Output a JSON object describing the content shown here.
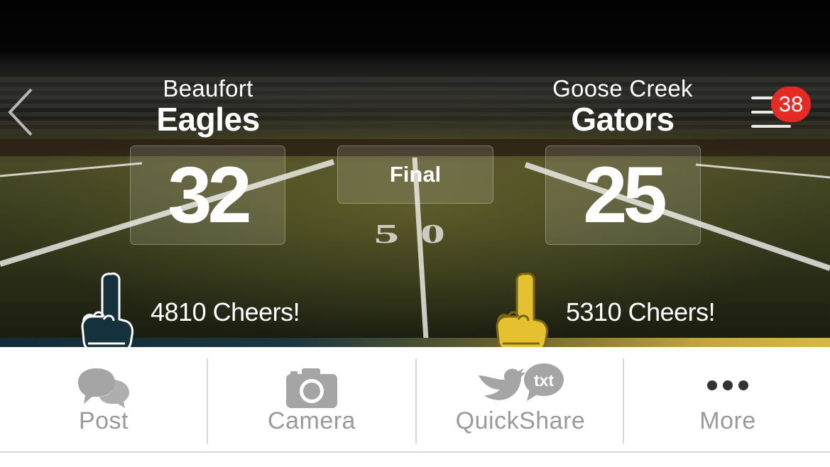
{
  "nav": {
    "back_icon": "chevron-left-icon",
    "menu_icon": "hamburger-menu-icon",
    "notification_count": "38"
  },
  "game": {
    "status": "Final",
    "home": {
      "city": "Beaufort",
      "name": "Eagles",
      "score": "32",
      "cheers": "4810 Cheers!",
      "color": "#15313b",
      "cheer_icon": "foam-finger-icon"
    },
    "away": {
      "city": "Goose Creek",
      "name": "Gators",
      "score": "25",
      "cheers": "5310 Cheers!",
      "color": "#d9b83a",
      "cheer_icon": "foam-finger-icon"
    }
  },
  "field": {
    "yard_marker": "50"
  },
  "actions": [
    {
      "label": "Post",
      "icon": "speech-bubbles-icon"
    },
    {
      "label": "Camera",
      "icon": "camera-icon"
    },
    {
      "label": "QuickShare",
      "icon": "twitter-txt-icon",
      "icon_text": "txt"
    },
    {
      "label": "More",
      "icon": "ellipsis-icon"
    }
  ],
  "colors": {
    "badge": "#e62b25",
    "action_gray": "#9a9a9a"
  }
}
